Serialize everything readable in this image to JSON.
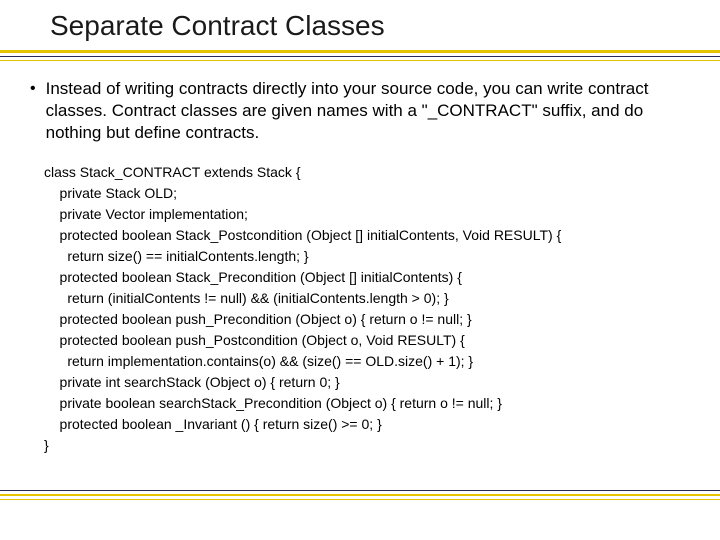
{
  "title": "Separate Contract Classes",
  "bullet": "Instead of writing contracts directly into your source code, you can write contract classes. Contract classes are given names with a \"_CONTRACT\" suffix, and do nothing but define contracts.",
  "code": "class Stack_CONTRACT extends Stack {\n    private Stack OLD;\n    private Vector implementation;\n    protected boolean Stack_Postcondition (Object [] initialContents, Void RESULT) {\n      return size() == initialContents.length; }\n    protected boolean Stack_Precondition (Object [] initialContents) {\n      return (initialContents != null) && (initialContents.length > 0); }\n    protected boolean push_Precondition (Object o) { return o != null; }\n    protected boolean push_Postcondition (Object o, Void RESULT) {\n      return implementation.contains(o) && (size() == OLD.size() + 1); }\n    private int searchStack (Object o) { return 0; }\n    private boolean searchStack_Precondition (Object o) { return o != null; }\n    protected boolean _Invariant () { return size() >= 0; }\n}"
}
